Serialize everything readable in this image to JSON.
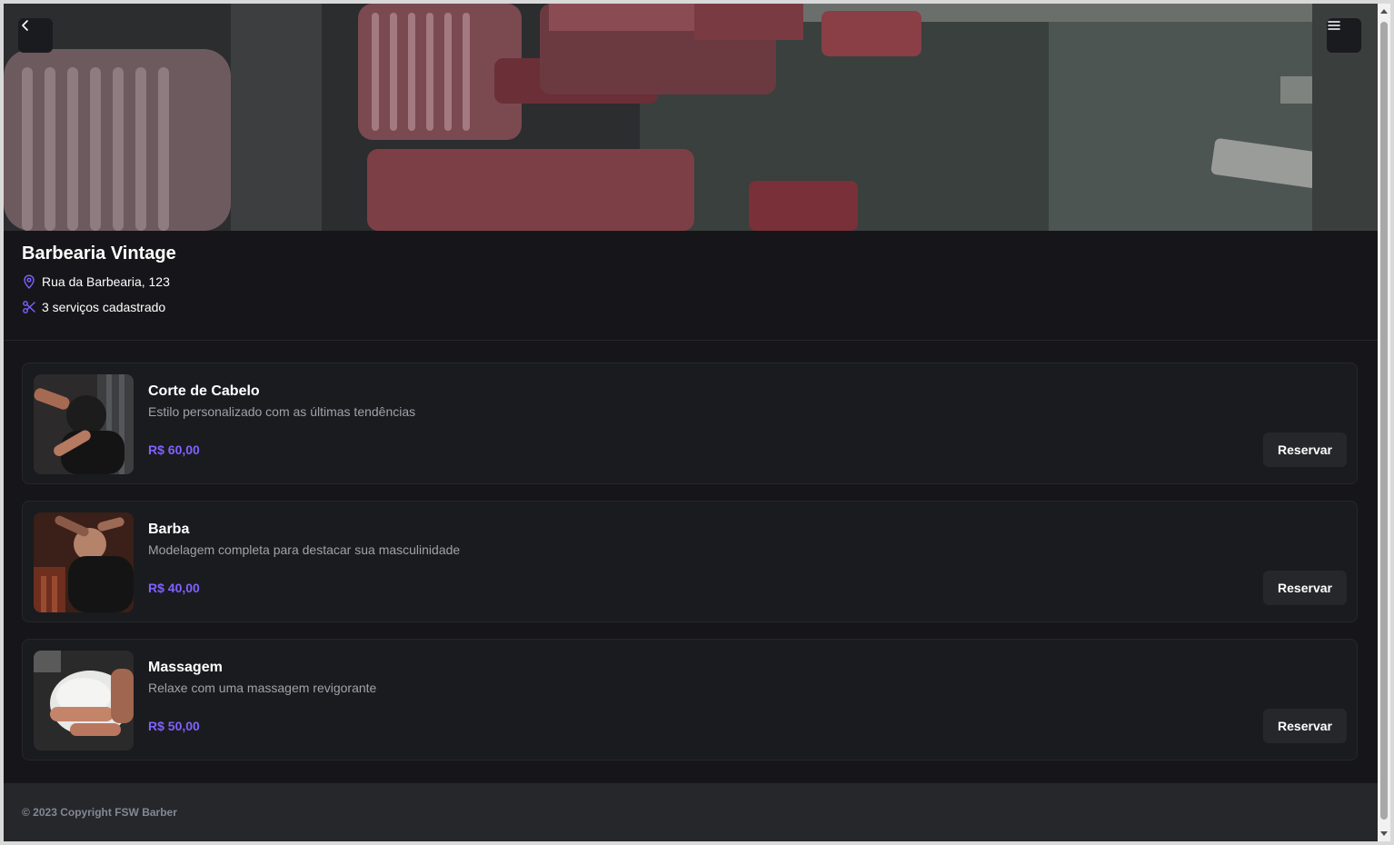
{
  "colors": {
    "background": "#16161a",
    "card": "#1a1b1f",
    "border": "#26272b",
    "accent": "#8161ff",
    "muted_text": "#a1a1aa",
    "footer_text": "#838896"
  },
  "header": {
    "back_icon": "chevron-left-icon",
    "menu_icon": "menu-icon",
    "hero_image": "barbershop-chairs-photo"
  },
  "barbershop": {
    "name": "Barbearia Vintage",
    "address": "Rua da Barbearia, 123",
    "address_icon": "map-pin-icon",
    "services_count": "3 serviços cadastrado",
    "services_icon": "scissors-icon"
  },
  "services": [
    {
      "name": "Corte de Cabelo",
      "description": "Estilo personalizado com as últimas tendências",
      "price": "R$ 60,00",
      "button_label": "Reservar",
      "image": "haircut-photo"
    },
    {
      "name": "Barba",
      "description": "Modelagem completa para destacar sua masculinidade",
      "price": "R$ 40,00",
      "button_label": "Reservar",
      "image": "beard-trim-photo"
    },
    {
      "name": "Massagem",
      "description": "Relaxe com uma massagem revigorante",
      "price": "R$ 50,00",
      "button_label": "Reservar",
      "image": "massage-photo"
    }
  ],
  "footer": {
    "copyright": "© 2023 Copyright FSW Barber"
  }
}
